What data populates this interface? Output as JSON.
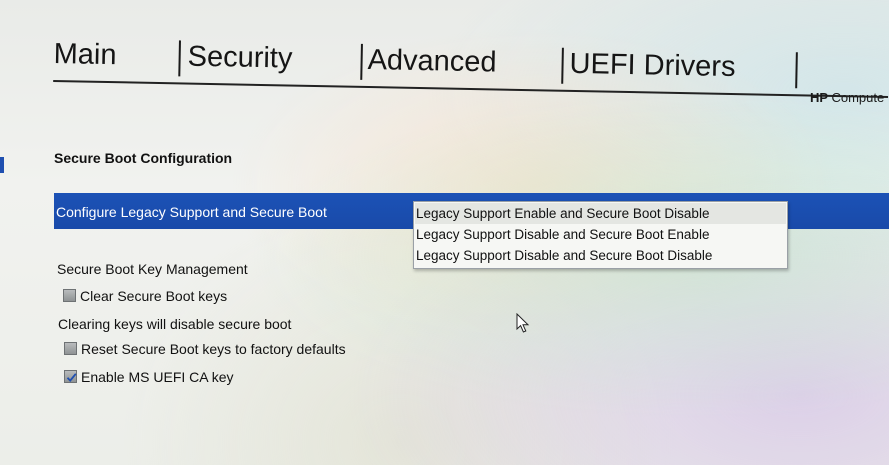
{
  "tabs": [
    {
      "label": "Main"
    },
    {
      "label": "Security"
    },
    {
      "label": "Advanced"
    },
    {
      "label": "UEFI Drivers"
    }
  ],
  "brand": {
    "bold": "HP",
    "rest": "Compute"
  },
  "section_title": "Secure Boot Configuration",
  "legacy_setting": {
    "label": "Configure Legacy Support and Secure Boot",
    "options": [
      "Legacy Support Enable and Secure Boot Disable",
      "Legacy Support Disable and Secure Boot Enable",
      "Legacy Support Disable and Secure Boot Disable"
    ],
    "selected_index": 0
  },
  "key_management": {
    "title": "Secure Boot Key Management",
    "clear_keys": {
      "label": "Clear Secure Boot keys",
      "checked": false
    },
    "warning": "Clearing keys will disable secure boot",
    "reset_keys": {
      "label": "Reset Secure Boot keys to factory defaults",
      "checked": false
    },
    "ms_uefi_ca": {
      "label": "Enable MS UEFI CA key",
      "checked": true
    }
  },
  "colors": {
    "highlight": "#1c52b6",
    "highlight_text": "#ffffff",
    "checkbox": "#9fa3a4"
  },
  "icons": {
    "cursor": "mouse-pointer-icon",
    "check": "checkmark-icon"
  }
}
